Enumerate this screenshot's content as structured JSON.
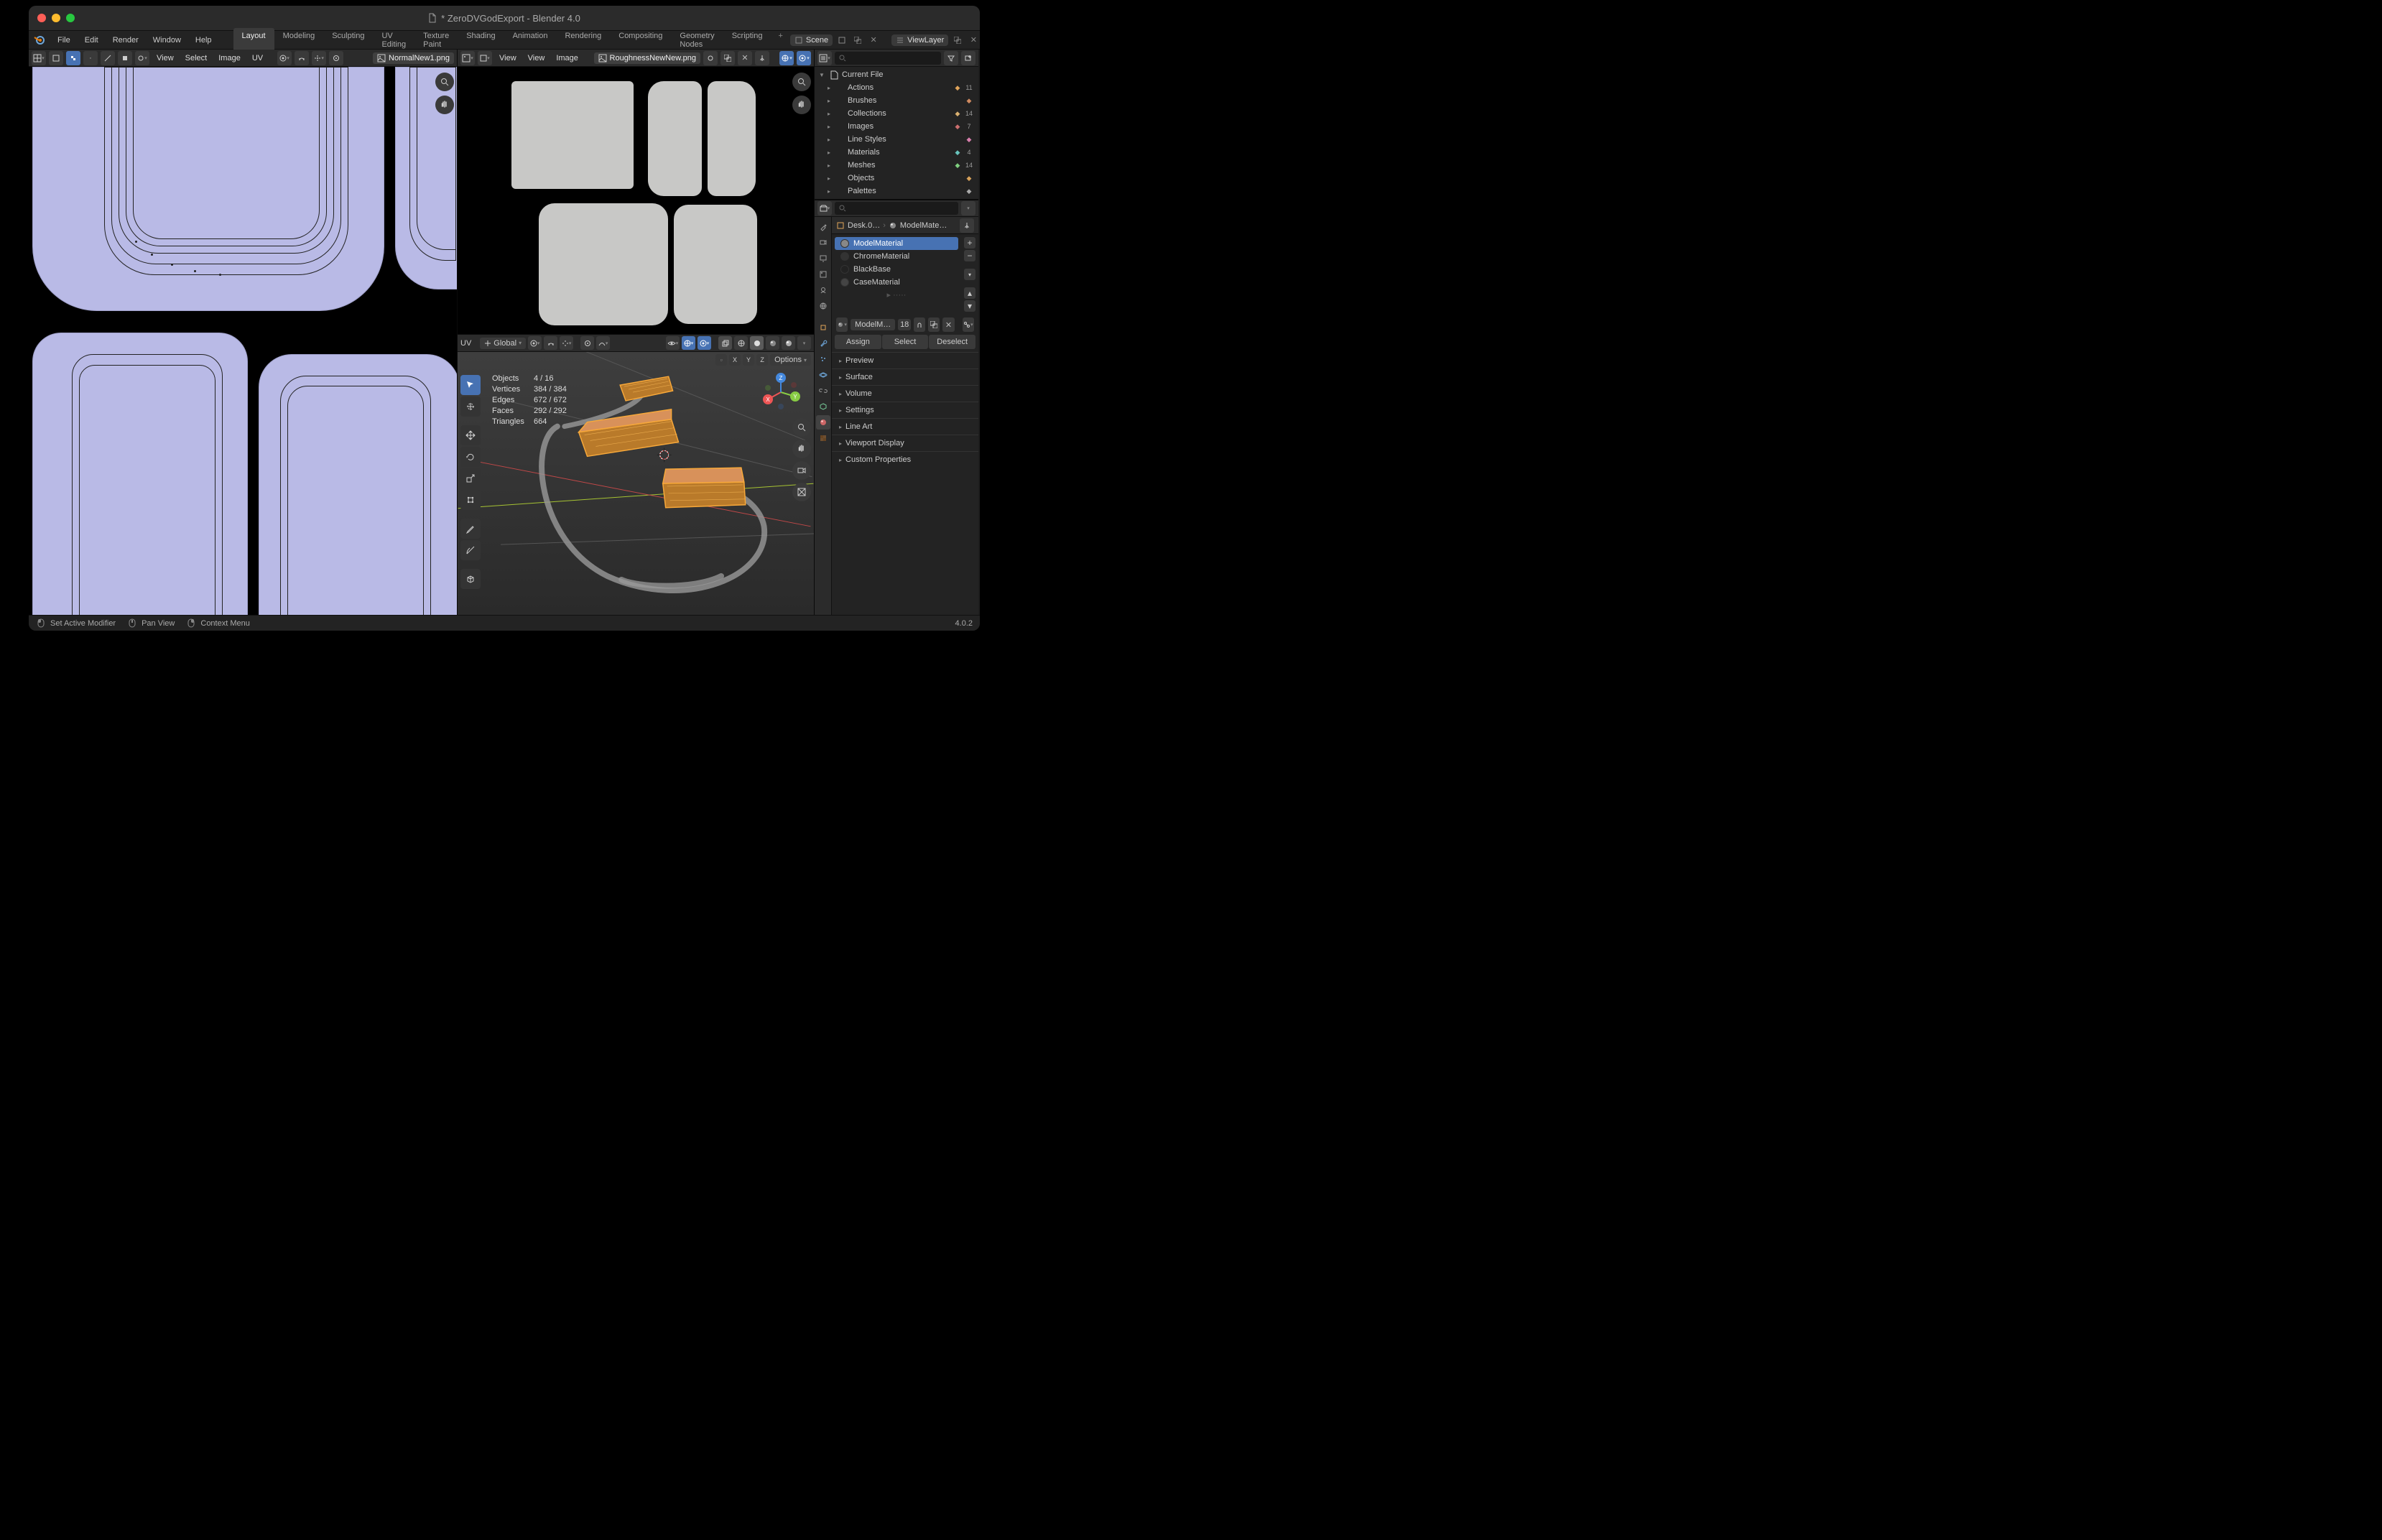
{
  "window": {
    "title": "* ZeroDVGodExport - Blender 4.0"
  },
  "traffic": {
    "close": "#ff5f57",
    "min": "#febc2e",
    "max": "#28c840"
  },
  "menus": [
    "File",
    "Edit",
    "Render",
    "Window",
    "Help"
  ],
  "workspaces": {
    "active": "Layout",
    "tabs": [
      "Layout",
      "Modeling",
      "Sculpting",
      "UV Editing",
      "Texture Paint",
      "Shading",
      "Animation",
      "Rendering",
      "Compositing",
      "Geometry Nodes",
      "Scripting"
    ]
  },
  "scene": {
    "label": "Scene"
  },
  "viewlayer": {
    "label": "ViewLayer"
  },
  "uv_editor": {
    "menus": [
      "View",
      "Select",
      "Image",
      "UV"
    ],
    "image": "NormalNew1.png"
  },
  "image_editor": {
    "menus": [
      "View",
      "View",
      "Image"
    ],
    "image": "RoughnessNewNew.png"
  },
  "viewport": {
    "menus": [
      "UV"
    ],
    "orientation": "Global",
    "axes": [
      "X",
      "Y",
      "Z"
    ],
    "options": "Options",
    "stats": {
      "objects_label": "Objects",
      "objects": "4 / 16",
      "vertices_label": "Vertices",
      "vertices": "384 / 384",
      "edges_label": "Edges",
      "edges": "672 / 672",
      "faces_label": "Faces",
      "faces": "292 / 292",
      "triangles_label": "Triangles",
      "triangles": "664"
    }
  },
  "outliner": {
    "root": "Current File",
    "items": [
      {
        "label": "Actions",
        "badge": "11",
        "color": "#e0a45a"
      },
      {
        "label": "Brushes",
        "badge": "",
        "color": "#d08a60"
      },
      {
        "label": "Collections",
        "badge": "14",
        "color": "#d9b070"
      },
      {
        "label": "Images",
        "badge": "7",
        "color": "#cc6f6f"
      },
      {
        "label": "Line Styles",
        "badge": "",
        "color": "#d87fad"
      },
      {
        "label": "Materials",
        "badge": "4",
        "color": "#68c4bc"
      },
      {
        "label": "Meshes",
        "badge": "14",
        "color": "#7fcf7f"
      },
      {
        "label": "Objects",
        "badge": "",
        "color": "#d8a25a"
      },
      {
        "label": "Palettes",
        "badge": "",
        "color": "#aaa"
      }
    ]
  },
  "breadcrumb": {
    "obj": "Desk.0…",
    "mat": "ModelMate…"
  },
  "materials": {
    "list": [
      "ModelMaterial",
      "ChromeMaterial",
      "BlackBase",
      "CaseMaterial"
    ],
    "selected": "ModelMaterial",
    "chip": "ModelM…",
    "users": "18",
    "assign": "Assign",
    "select": "Select",
    "deselect": "Deselect"
  },
  "panels": [
    "Preview",
    "Surface",
    "Volume",
    "Settings",
    "Line Art",
    "Viewport Display",
    "Custom Properties"
  ],
  "statusbar": {
    "modifier": "Set Active Modifier",
    "pan": "Pan View",
    "context": "Context Menu",
    "version": "4.0.2"
  }
}
